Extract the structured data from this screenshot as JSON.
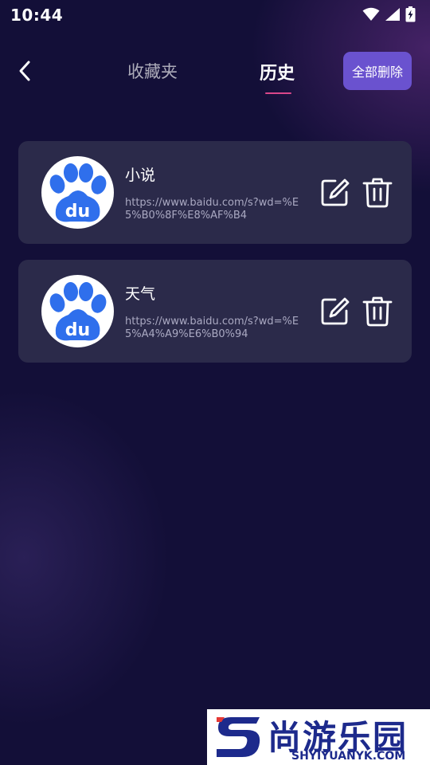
{
  "status_bar": {
    "time": "10:44",
    "icons": [
      "wifi-icon",
      "signal-icon",
      "battery-charging-icon"
    ]
  },
  "nav": {
    "back_icon": "chevron-left-icon",
    "tabs": [
      {
        "label": "收藏夹",
        "active": false
      },
      {
        "label": "历史",
        "active": true
      }
    ],
    "delete_all_label": "全部删除",
    "colors": {
      "accent": "#6a52cf",
      "underline": "#d9478a"
    }
  },
  "history": [
    {
      "title": "小说",
      "url": "https://www.baidu.com/s?wd=%E5%B0%8F%E8%AF%B4",
      "logo": "baidu-paw-icon",
      "logo_text": "du"
    },
    {
      "title": "天气",
      "url": "https://www.baidu.com/s?wd=%E5%A4%A9%E6%B0%94",
      "logo": "baidu-paw-icon",
      "logo_text": "du"
    }
  ],
  "watermark": {
    "name": "尚游乐园",
    "domain": "SHYIYUANYK.COM"
  },
  "colors": {
    "background": "#130f38",
    "card": "#2b2a4a",
    "baidu_blue": "#2f6fec"
  }
}
